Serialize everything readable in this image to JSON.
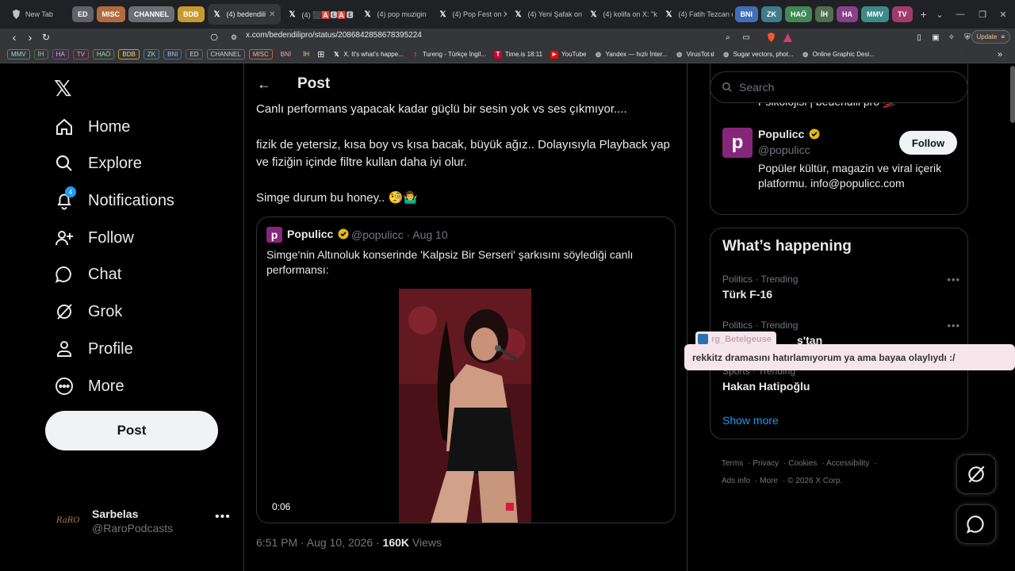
{
  "browser": {
    "groups": [
      "ED",
      "MISC",
      "CHANNEL",
      "BDB",
      "BNI",
      "ZK",
      "HAÖ",
      "İH",
      "HA",
      "MMV",
      "TV"
    ],
    "group_colors": {
      "ED": "#5f6368",
      "MISC": "#b36a3e",
      "CHANNEL": "#6b6f75",
      "BDB": "#c89a2e",
      "BNI": "#3f6fb8",
      "ZK": "#3e7c8a",
      "HAÖ": "#3d8a55",
      "İH": "#4f6f4f",
      "HA": "#8a3f8a",
      "MMV": "#3d8a8a",
      "TV": "#a03c6a"
    },
    "tabs": [
      {
        "label": "New Tab",
        "icon": "brave-icon"
      },
      {
        "label": "(4) bedendili",
        "icon": "x-icon"
      },
      {
        "label": "(4) ⬛🅰️🅻🅰️🅴",
        "icon": "x-icon"
      },
      {
        "label": "(4) pop muzigin",
        "icon": "x-icon"
      },
      {
        "label": "(4) Pop Fest on X",
        "icon": "x-icon"
      },
      {
        "label": "(4) Yeni Şafak on",
        "icon": "x-icon"
      },
      {
        "label": "(4) kolifa on X: \"k",
        "icon": "x-icon"
      },
      {
        "label": "(4) Fatih Tezcan o",
        "icon": "x-icon"
      }
    ],
    "url": "x.com/bedendilipro/status/2086842858678395224",
    "update_label": "Update",
    "bookmark_groups": [
      "MMV",
      "İH",
      "HA",
      "TV",
      "HAÖ",
      "BDB",
      "ZK",
      "BNI",
      "ED",
      "CHANNEL",
      "MISC",
      "BNİ",
      "İH"
    ],
    "bookmarks": [
      {
        "label": "X. It's what's happe...",
        "icon": "x-icon"
      },
      {
        "label": "Tureng - Türkçe İngil...",
        "icon": "tureng-icon"
      },
      {
        "label": "Time.is 18:11",
        "icon": "time-icon"
      },
      {
        "label": "YouTube",
        "icon": "youtube-icon"
      },
      {
        "label": "Yandex — hızlı İnter...",
        "icon": "globe-icon"
      },
      {
        "label": "VirusTotal",
        "icon": "globe-icon"
      },
      {
        "label": "Sugar vectors, phot...",
        "icon": "globe-icon"
      },
      {
        "label": "Online Graphic Desi...",
        "icon": "globe-icon"
      }
    ]
  },
  "nav": {
    "items": [
      {
        "label": "Home",
        "icon": "home-icon"
      },
      {
        "label": "Explore",
        "icon": "search-icon"
      },
      {
        "label": "Notifications",
        "icon": "bell-icon",
        "badge": "4"
      },
      {
        "label": "Follow",
        "icon": "person-add-icon"
      },
      {
        "label": "Chat",
        "icon": "chat-icon"
      },
      {
        "label": "Grok",
        "icon": "grok-icon"
      },
      {
        "label": "Profile",
        "icon": "person-icon"
      },
      {
        "label": "More",
        "icon": "more-circle-icon"
      }
    ],
    "post_button": "Post",
    "account": {
      "name": "Sarbelas",
      "handle": "@RaroPodcasts",
      "logo_text": "RaRO"
    }
  },
  "post": {
    "header_title": "Post",
    "text_lines": [
      "Canlı performans yapacak kadar güçlü bir sesin yok vs ses çıkmıyor....",
      "fizik de yetersiz, kısa boy vs ḳısa bacak, büyük ağız.. Dolayısıyla Playback yap ve fiziğin içinde filtre kullan daha iyi olur.",
      "Simge durum bu honey.. 🧐🤷‍♂️"
    ],
    "quote": {
      "name": "Populicc",
      "handle_date": "@populicc · Aug 10",
      "text": "Simge'nin Altınoluk konserinde 'Kalpsiz Bir Serseri' şarkısını söylediği canlı performansı:",
      "video_time": "0:06"
    },
    "meta": {
      "time": "6:51 PM · Aug 10, 2026 · ",
      "views_count": "160K",
      "views_label": " Views"
    }
  },
  "sidebar": {
    "search_placeholder": "Search",
    "prev_desc": "Psikolojisi | bedendili pro 💯",
    "populicc": {
      "name": "Populicc",
      "handle": "@populicc",
      "bio": "Popüler kültür, magazin ve viral içerik platformu. info@populicc.com",
      "follow": "Follow"
    },
    "trends_title": "What’s happening",
    "trends": [
      {
        "category": "Politics · Trending",
        "name": "Türk F-16"
      },
      {
        "category": "Politics · Trending",
        "name": "s'tan"
      },
      {
        "category": "Sports · Trending",
        "name": "Hakan Hatipoğlu"
      }
    ],
    "show_more": "Show more",
    "footer": [
      "Terms",
      "Privacy",
      "Cookies",
      "Accessibility",
      "Ads info",
      "More",
      "© 2026 X Corp."
    ]
  },
  "chat_overlay": {
    "user": "rg_Betelgeuse",
    "message": "rekkitz dramasını hatırlamıyorum ya ama bayaa olaylıydı :/"
  },
  "colors": {
    "accent": "#1d9bf0",
    "verified": "#e2b719",
    "populicc": "#86267a"
  }
}
